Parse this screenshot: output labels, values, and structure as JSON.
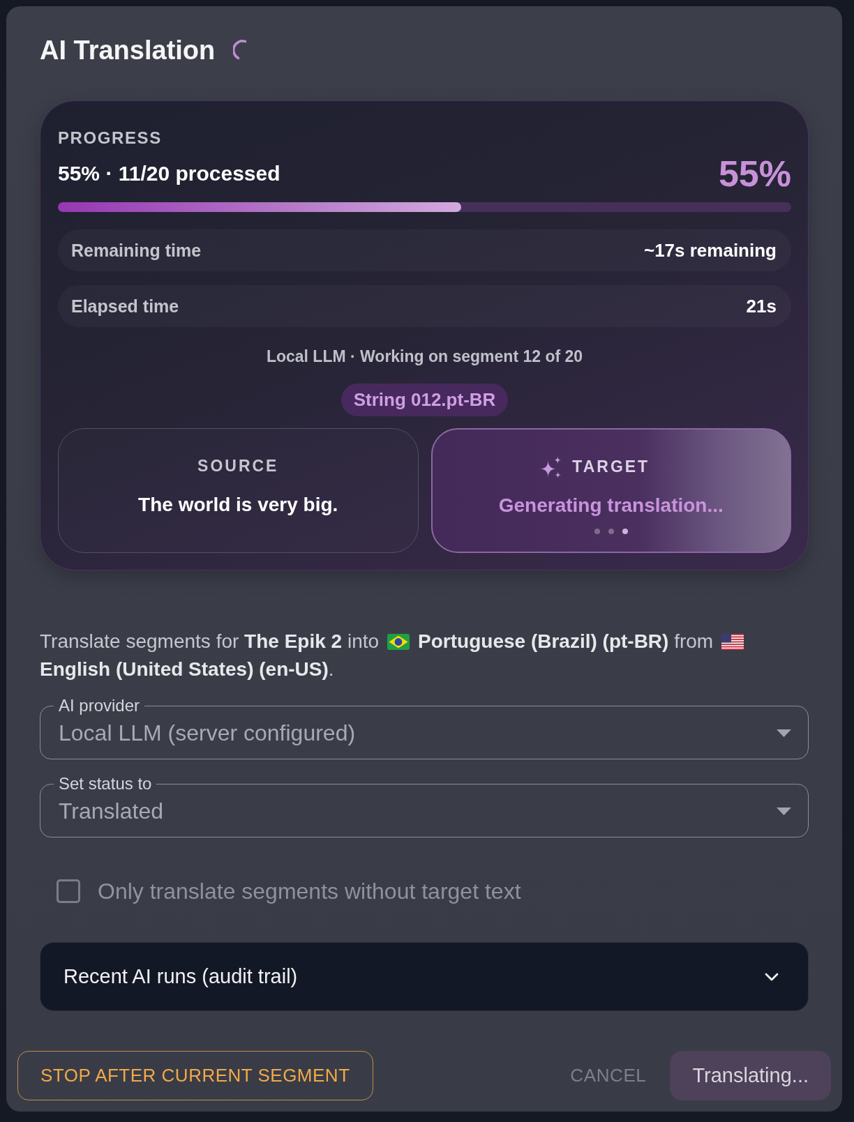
{
  "dialog": {
    "title": "AI Translation"
  },
  "progress": {
    "heading": "PROGRESS",
    "summary": "55% · 11/20 processed",
    "percent": "55%",
    "level": 0.55,
    "stats": [
      {
        "label": "Remaining time",
        "value": "~17s remaining"
      },
      {
        "label": "Elapsed time",
        "value": "21s"
      }
    ],
    "status": "Local LLM · Working on segment 12 of 20",
    "current_item": "String 012.pt-BR",
    "panels": [
      {
        "kind": "source",
        "label": "SOURCE",
        "text": "The world is very big."
      },
      {
        "kind": "target",
        "label": "TARGET",
        "text": "Generating translation..."
      }
    ]
  },
  "description": {
    "parts": [
      "Translate segments for **The Epik 2** into",
      "**Portuguese (Brazil) (pt-BR)** from",
      "**English (United States) (en-US)**."
    ]
  },
  "fields": [
    {
      "label": "AI provider",
      "value": "Local LLM (server configured)",
      "disabled": true
    },
    {
      "label": "Set status to",
      "value": "Translated",
      "disabled": true
    }
  ],
  "options": [
    {
      "label": "Only translate segments without target text",
      "checked": false,
      "disabled": true
    }
  ],
  "audit_trail": {
    "label": "Recent AI runs (audit trail)",
    "expanded": false
  },
  "buttons": [
    {
      "kind": "outline",
      "label": "STOP AFTER CURRENT SEGMENT",
      "disabled": false
    },
    {
      "kind": "text",
      "label": "CANCEL",
      "disabled": true
    },
    {
      "kind": "filled",
      "label": "Translating...",
      "disabled": true
    }
  ]
}
